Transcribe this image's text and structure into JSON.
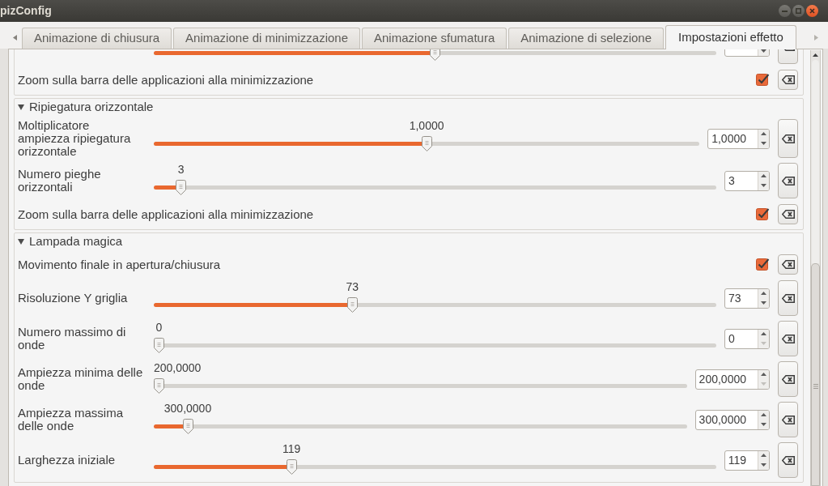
{
  "window": {
    "title": "pizConfig"
  },
  "tabs": [
    {
      "label": "Animazione di chiusura",
      "selected": false
    },
    {
      "label": "Animazione di minimizzazione",
      "selected": false
    },
    {
      "label": "Animazione sfumatura",
      "selected": false
    },
    {
      "label": "Animazione di selezione",
      "selected": false
    },
    {
      "label": "Impostazioni effetto",
      "selected": true
    }
  ],
  "groups": [
    {
      "rows": [
        {
          "kind": "slider",
          "level": 0.5
        },
        {
          "kind": "checkbox",
          "label": "Zoom sulla barra delle applicazioni alla minimizzazione",
          "checked": true
        }
      ]
    },
    {
      "title": "Ripiegatura orizzontale",
      "expanded": true,
      "rows": [
        {
          "kind": "slider",
          "label": "Moltiplicatore ampiezza ripiegatura orizzontale",
          "slider_value": "1,0000",
          "level": 0.5,
          "field_value": "1,0000",
          "decrement_disabled": false
        },
        {
          "kind": "slider",
          "label": "Numero pieghe orizzontali",
          "slider_value": "3",
          "level": 0.04,
          "field_value": "3",
          "decrement_disabled": false
        },
        {
          "kind": "checkbox",
          "label": "Zoom sulla barra delle applicazioni alla minimizzazione",
          "checked": true
        }
      ]
    },
    {
      "title": "Lampada magica",
      "expanded": true,
      "rows": [
        {
          "kind": "checkbox",
          "label": "Movimento finale in apertura/chiusura",
          "checked": true
        },
        {
          "kind": "slider",
          "label": "Risoluzione Y griglia",
          "slider_value": "73",
          "level": 0.35,
          "field_value": "73",
          "decrement_disabled": false
        },
        {
          "kind": "slider",
          "label": "Numero massimo di onde",
          "slider_value": "0",
          "level": 0,
          "field_value": "0",
          "decrement_disabled": true
        },
        {
          "kind": "slider",
          "label": "Ampiezza minima delle onde",
          "slider_value": "200,0000",
          "level": 0,
          "field_value": "200,0000",
          "decrement_disabled": true
        },
        {
          "kind": "slider",
          "label": "Ampiezza massima delle onde",
          "slider_value": "300,0000",
          "level": 0.055,
          "field_value": "300,0000",
          "decrement_disabled": false
        },
        {
          "kind": "slider",
          "label": "Larghezza iniziale",
          "slider_value": "119",
          "level": 0.24,
          "field_value": "119",
          "decrement_disabled": false
        }
      ]
    }
  ]
}
